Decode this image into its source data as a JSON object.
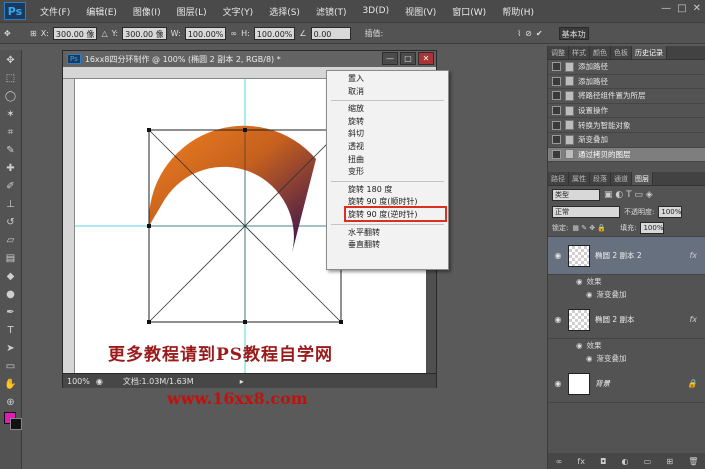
{
  "app": {
    "logo": "Ps",
    "menu": [
      "文件(F)",
      "编辑(E)",
      "图像(I)",
      "图层(L)",
      "文字(Y)",
      "选择(S)",
      "滤镜(T)",
      "3D(D)",
      "视图(V)",
      "窗口(W)",
      "帮助(H)"
    ]
  },
  "options": {
    "x_label": "X:",
    "x_value": "300.00 像",
    "y_label": "Y:",
    "y_value": "300.00 像",
    "w_label": "W:",
    "w_value": "100.00%",
    "h_label": "H:",
    "h_value": "100.00%",
    "angle_value": "0.00",
    "interp_label": "插值:",
    "mode": "基本功"
  },
  "document": {
    "title": "16xx8四分环制作 @ 100% (椭圆 2 副本 2, RGB/8) *",
    "zoom": "100%",
    "status": "文档:1.03M/1.63M"
  },
  "window_buttons": [
    "—",
    "□",
    "✕"
  ],
  "context_menu": {
    "items": [
      "置入",
      "取消",
      "缩放",
      "旋转",
      "斜切",
      "透视",
      "扭曲",
      "变形",
      "旋转 180 度",
      "旋转 90 度(顺时针)",
      "旋转 90 度(逆时针)",
      "水平翻转",
      "垂直翻转"
    ],
    "highlighted": "旋转 90 度(顺时针)"
  },
  "panel_top": {
    "tabs": [
      "调整",
      "样式",
      "颜色",
      "色板",
      "历史记录"
    ],
    "history": [
      "添加路径",
      "添加路径",
      "将路径组件置为所层",
      "设置操作",
      "转换为智能对象",
      "渐变叠加",
      "通过拷贝的图层"
    ],
    "active_index": 6
  },
  "layers": {
    "tabs": [
      "路径",
      "属性",
      "段落",
      "通道",
      "图层"
    ],
    "kind": "类型",
    "blend": "正常",
    "opacity_label": "不透明度:",
    "opacity": "100%",
    "lock_label": "锁定:",
    "fill_label": "填充:",
    "fill": "100%",
    "items": [
      {
        "name": "椭圆 2 副本 2",
        "fx": "fx",
        "effect_label": "效果",
        "effect": "渐变叠加",
        "active": true
      },
      {
        "name": "椭圆 2 副本",
        "fx": "fx",
        "effect_label": "效果",
        "effect": "渐变叠加",
        "active": false
      },
      {
        "name": "背景",
        "fx": "",
        "effect_label": "",
        "effect": "",
        "active": false
      }
    ]
  },
  "canvas": {
    "watermark": "更多教程请到PS教程自学网",
    "site": "www.16xx8.com"
  },
  "colors": {
    "foreground": "#e01cb5",
    "background": "#111111",
    "highlight": "#d9301f"
  }
}
